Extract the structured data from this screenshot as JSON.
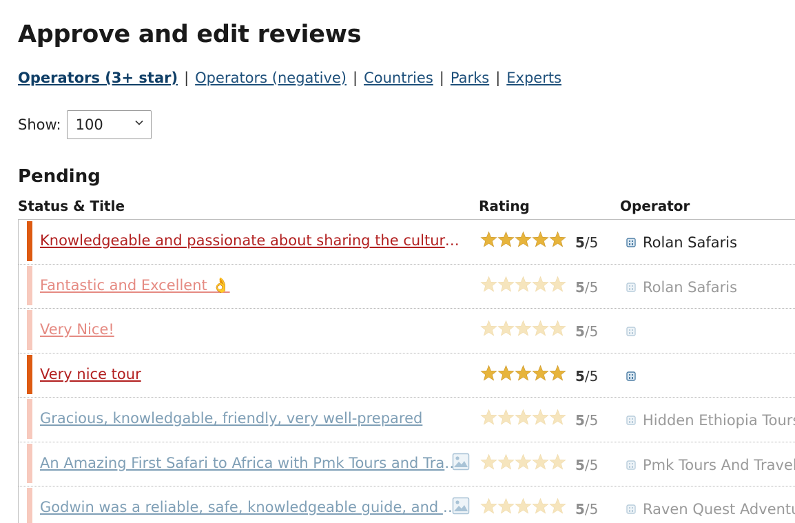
{
  "page_title": "Approve and edit reviews",
  "nav": {
    "links": [
      {
        "label": "Operators (3+ star)",
        "active": true
      },
      {
        "label": "Operators (negative)",
        "active": false
      },
      {
        "label": "Countries",
        "active": false
      },
      {
        "label": "Parks",
        "active": false
      },
      {
        "label": "Experts",
        "active": false
      }
    ],
    "separator": "|"
  },
  "show": {
    "label": "Show:",
    "value": "100"
  },
  "section_title": "Pending",
  "columns": {
    "status_title": "Status & Title",
    "rating": "Rating",
    "operator": "Operator"
  },
  "colors": {
    "bar_active": "#dd5a12",
    "bar_pending": "#f7c9bd",
    "title_active": "#b21f1f",
    "title_faded_red": "#e58a82",
    "title_faded_blue": "#7f9fb6",
    "star": "#e7b43b",
    "star_faded": "#f6e5bd"
  },
  "rows": [
    {
      "title": "Knowledgeable and passionate about sharing the culture of Uganda",
      "rating": "5",
      "out_of": "/5",
      "operator": "Rolan Safaris",
      "state": "active",
      "photo": false
    },
    {
      "title": "Fantastic and Excellent 👌",
      "rating": "5",
      "out_of": "/5",
      "operator": "Rolan Safaris",
      "state": "faded-red",
      "photo": false
    },
    {
      "title": "Very Nice!",
      "rating": "5",
      "out_of": "/5",
      "operator": "",
      "state": "faded-red",
      "photo": false
    },
    {
      "title": "Very nice tour",
      "rating": "5",
      "out_of": "/5",
      "operator": "",
      "state": "active",
      "photo": false
    },
    {
      "title": "Gracious, knowledgable, friendly, very well-prepared",
      "rating": "5",
      "out_of": "/5",
      "operator": "Hidden Ethiopia Tours",
      "state": "faded-blue",
      "photo": false
    },
    {
      "title": "An Amazing First Safari to Africa with Pmk Tours and Travel",
      "rating": "5",
      "out_of": "/5",
      "operator": "Pmk Tours And Travel",
      "state": "faded-blue",
      "photo": true
    },
    {
      "title": "Godwin was a reliable, safe, knowledgeable guide, and a great companion",
      "rating": "5",
      "out_of": "/5",
      "operator": "Raven Quest Adventures",
      "state": "faded-blue",
      "photo": true
    }
  ]
}
